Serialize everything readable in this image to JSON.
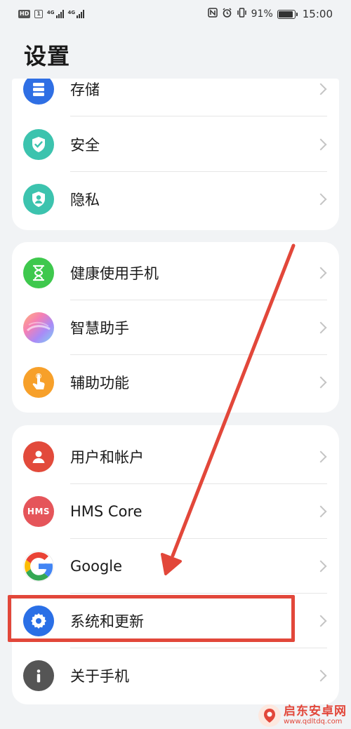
{
  "status_bar": {
    "hd": "HD",
    "sim": "1",
    "net1": "4G",
    "net2": "4G",
    "battery_percent_text": "91%",
    "battery_level": 0.91,
    "time": "15:00"
  },
  "page": {
    "title": "设置"
  },
  "groups": [
    {
      "items": [
        {
          "label": "存储",
          "icon": "storage-icon",
          "color": "#2f6fe4"
        },
        {
          "label": "安全",
          "icon": "shield-check-icon",
          "color": "#3cc3ae"
        },
        {
          "label": "隐私",
          "icon": "privacy-shield-icon",
          "color": "#3cc3ae"
        }
      ]
    },
    {
      "items": [
        {
          "label": "健康使用手机",
          "icon": "hourglass-icon",
          "color": "#3ec84d"
        },
        {
          "label": "智慧助手",
          "icon": "assistant-orb-icon",
          "color": "#b98cf0"
        },
        {
          "label": "辅助功能",
          "icon": "hand-pointer-icon",
          "color": "#f7a02a"
        }
      ]
    },
    {
      "items": [
        {
          "label": "用户和帐户",
          "icon": "user-icon",
          "color": "#e24a3b"
        },
        {
          "label": "HMS Core",
          "icon": "hms-icon",
          "color": "#e5555a"
        },
        {
          "label": "Google",
          "icon": "google-icon",
          "color": "#ffffff"
        },
        {
          "label": "系统和更新",
          "icon": "gear-icon",
          "color": "#2a6fe6"
        },
        {
          "label": "关于手机",
          "icon": "info-icon",
          "color": "#555555"
        }
      ]
    }
  ],
  "icon_text": {
    "hms": "HMS"
  },
  "watermark": {
    "title": "启东安卓网",
    "url": "www.qdltdq.com"
  },
  "colors": {
    "accent_red": "#e2473a",
    "background": "#f1f3f5"
  }
}
